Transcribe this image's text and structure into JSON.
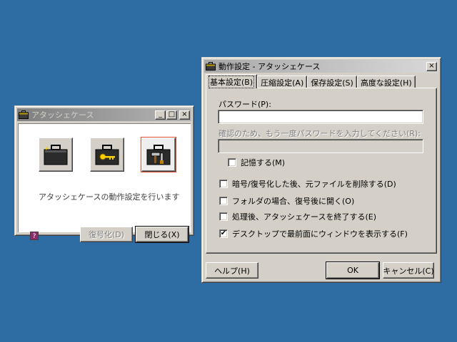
{
  "colors": {
    "desktop": "#2d6da3",
    "face": "#d4d0c8",
    "selection_frame": "#e05030"
  },
  "small_window": {
    "title": "アタッシェケース",
    "title_buttons": {
      "minimize": "_",
      "maximize": "□",
      "close": "×"
    },
    "icons": [
      "new-case-icon",
      "key-icon",
      "tools-icon"
    ],
    "message": "アタッシェケースの動作設定を行います",
    "help_icon_glyph": "?",
    "decrypt_button": "復号化(D)",
    "close_button": "閉じる(X)"
  },
  "settings_window": {
    "title": "動作設定 - アタッシェケース",
    "close_glyph": "×",
    "tabs": [
      {
        "label": "基本設定(B)",
        "active": true
      },
      {
        "label": "圧縮設定(A)",
        "active": false
      },
      {
        "label": "保存設定(S)",
        "active": false
      },
      {
        "label": "高度な設定(H)",
        "active": false
      }
    ],
    "password_label": "パスワード(P):",
    "password_value": "",
    "confirm_label": "確認のため、もう一度パスワードを入力してください(R):",
    "confirm_value": "",
    "remember": {
      "label": "記憶する(M)",
      "checked": false,
      "mark": ""
    },
    "options": [
      {
        "label": "暗号/復号化した後、元ファイルを削除する(D)",
        "checked": false,
        "mark": ""
      },
      {
        "label": "フォルダの場合、復号後に開く(O)",
        "checked": false,
        "mark": ""
      },
      {
        "label": "処理後、アタッシェケースを終了する(E)",
        "checked": false,
        "mark": ""
      },
      {
        "label": "デスクトップで最前面にウィンドウを表示する(F)",
        "checked": true,
        "mark": "✔"
      }
    ],
    "help_button": "ヘルプ(H)",
    "ok_button": "OK",
    "cancel_button": "キャンセル(C)"
  }
}
